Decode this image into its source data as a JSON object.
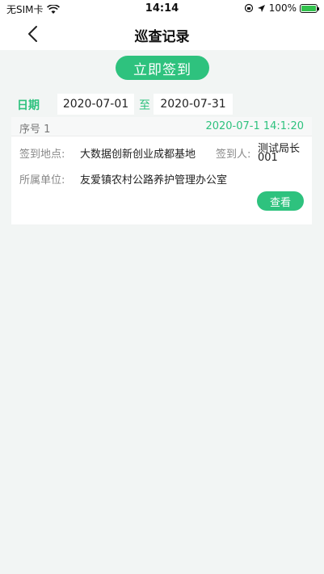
{
  "status_bar": {
    "carrier": "无SIM卡",
    "time": "14:14",
    "battery": "100%"
  },
  "navbar": {
    "title": "巡查记录"
  },
  "checkin": {
    "label": "立即签到"
  },
  "filter": {
    "date_label": "日期",
    "start_date": "2020-07-01",
    "separator": "至",
    "end_date": "2020-07-31"
  },
  "records": [
    {
      "seq": "序号 1",
      "time": "2020-07-1 14:1:20",
      "location_label": "签到地点:",
      "location": "大数据创新创业成都基地",
      "signer_label": "签到人:",
      "signer_line1": "测试局长",
      "signer_line2": "001",
      "unit_label": "所属单位:",
      "unit": "友爱镇农村公路养护管理办公室",
      "view_label": "查看"
    }
  ],
  "colors": {
    "accent": "#2ec27e",
    "background": "#f2f5f4"
  }
}
